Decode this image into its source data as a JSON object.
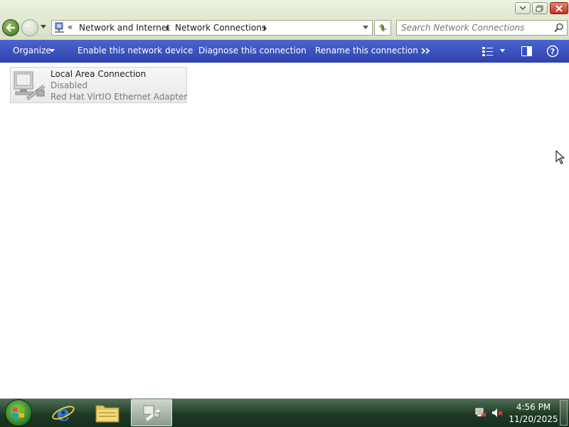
{
  "window": {
    "icons": {
      "minimize": "minimize-icon",
      "maximize": "restore-icon",
      "close": "close-icon"
    }
  },
  "address_bar": {
    "overflow_glyph": "«",
    "breadcrumbs": [
      {
        "label": "Network and Internet"
      },
      {
        "label": "Network Connections"
      }
    ],
    "icons": {
      "location": "network-location-icon",
      "refresh": "refresh-icon"
    }
  },
  "search": {
    "placeholder": "Search Network Connections",
    "value": "",
    "icon": "search-icon"
  },
  "command_bar": {
    "organize_label": "Organize",
    "items": [
      {
        "label": "Enable this network device"
      },
      {
        "label": "Diagnose this connection"
      },
      {
        "label": "Rename this connection"
      }
    ],
    "icons": {
      "more": "more-chevrons-icon",
      "views": "change-view-icon",
      "preview": "preview-pane-icon",
      "help": "help-icon"
    }
  },
  "connections": [
    {
      "name": "Local Area Connection",
      "status": "Disabled",
      "adapter": "Red Hat VirtIO Ethernet Adapter",
      "icon": "network-adapter-icon"
    }
  ],
  "taskbar": {
    "clock_time": "4:56 PM",
    "clock_date": "11/20/2025",
    "icons": {
      "start": "windows-logo-icon",
      "pinned": [
        "internet-explorer-icon",
        "windows-explorer-icon"
      ],
      "active": "network-connections-icon",
      "tray": [
        "network-disconnected-icon",
        "volume-muted-icon"
      ]
    }
  },
  "colors": {
    "command_bar": "#3a51bd",
    "chrome": "#dfe8d0",
    "taskbar": "#1e3a26",
    "close_button": "#c2301d"
  }
}
